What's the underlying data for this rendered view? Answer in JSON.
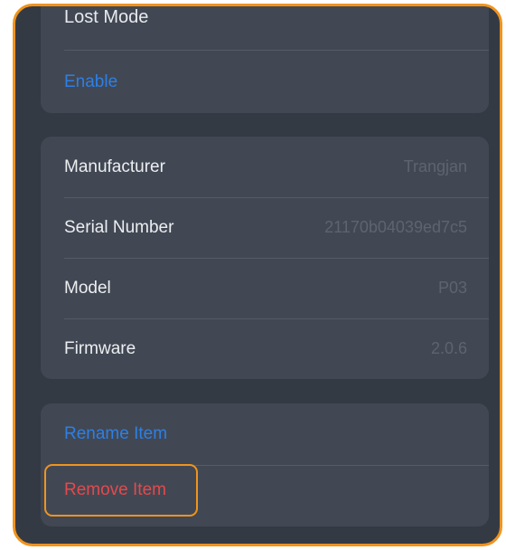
{
  "lost_mode": {
    "title": "Lost Mode",
    "enable_label": "Enable"
  },
  "info": {
    "rows": [
      {
        "label": "Manufacturer",
        "value": "Trangjan"
      },
      {
        "label": "Serial Number",
        "value": "21170b04039ed7c5"
      },
      {
        "label": "Model",
        "value": "P03"
      },
      {
        "label": "Firmware",
        "value": "2.0.6"
      }
    ]
  },
  "actions": {
    "rename_label": "Rename Item",
    "remove_label": "Remove Item"
  },
  "colors": {
    "highlight": "#f0931e",
    "link_blue": "#2e7fe6",
    "destructive_red": "#e5484d",
    "background": "#343a44",
    "card": "#414853"
  }
}
